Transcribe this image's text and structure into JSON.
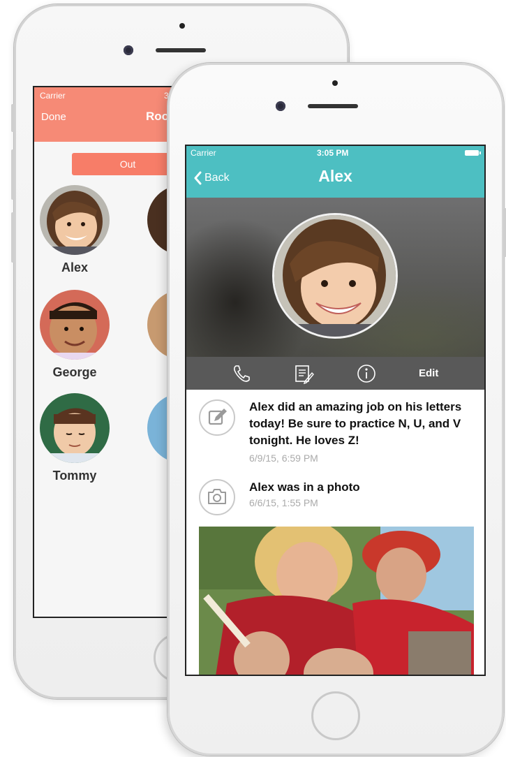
{
  "back_phone": {
    "status": {
      "carrier": "Carrier",
      "time_partial": "3"
    },
    "nav": {
      "left": "Done",
      "title_partial": "Roo"
    },
    "out_button": "Out",
    "students": [
      {
        "name": "Alex"
      },
      {
        "name": "George"
      },
      {
        "name": "Tommy"
      }
    ]
  },
  "front_phone": {
    "status": {
      "carrier": "Carrier",
      "time": "3:05 PM"
    },
    "nav": {
      "back_label": "Back",
      "title": "Alex"
    },
    "toolbar": {
      "edit_label": "Edit",
      "icons": [
        "phone-icon",
        "notes-icon",
        "info-icon"
      ]
    },
    "feed": [
      {
        "icon": "pencil-icon",
        "text": "Alex did an amazing job on his letters today!  Be sure to practice N, U, and V tonight. He loves Z!",
        "time": "6/9/15, 6:59 PM"
      },
      {
        "icon": "camera-icon",
        "text": "Alex was in a photo",
        "time": "6/6/15, 1:55 PM"
      }
    ]
  },
  "colors": {
    "back_accent": "#f68a76",
    "front_accent": "#4dbfc2",
    "toolbar": "#595959"
  }
}
